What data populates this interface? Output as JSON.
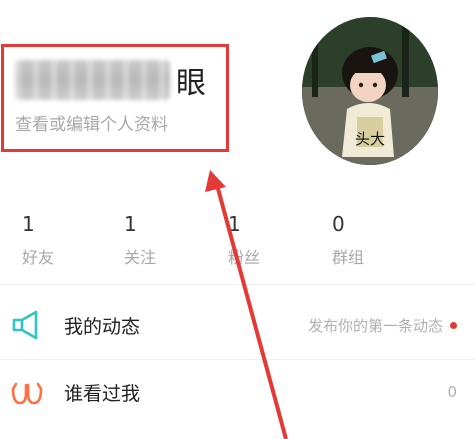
{
  "profile": {
    "name_suffix": "眼",
    "subtitle": "查看或编辑个人资料",
    "avatar_caption": "头大"
  },
  "stats": [
    {
      "value": "1",
      "label": "好友"
    },
    {
      "value": "1",
      "label": "关注"
    },
    {
      "value": "1",
      "label": "粉丝"
    },
    {
      "value": "0",
      "label": "群组"
    }
  ],
  "menu": {
    "my_moments": {
      "label": "我的动态",
      "hint": "发布你的第一条动态",
      "icon": "megaphone-icon"
    },
    "visitors": {
      "label": "谁看过我",
      "count": "0",
      "icon": "glasses-icon"
    }
  },
  "colors": {
    "accent_red": "#e53935",
    "teal": "#2ec4c4",
    "orange": "#ff7043"
  }
}
